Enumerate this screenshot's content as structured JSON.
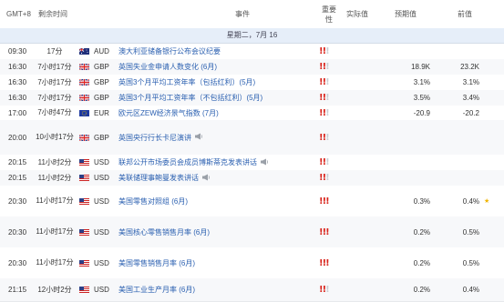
{
  "header": {
    "gmt": "GMT+8",
    "remaining": "剩余时间",
    "event": "事件",
    "importance_line1": "重要",
    "importance_line2": "性",
    "actual": "实际值",
    "forecast": "预期值",
    "previous": "前值"
  },
  "date_bar": "星期二，7月 16",
  "colors": {
    "accent_link": "#2a5fb0",
    "importance_high": "#d9251d",
    "importance_low": "#c9cdd3",
    "date_bar_bg": "#e6eef9"
  },
  "rows": [
    {
      "time": "09:30",
      "remaining": "17分",
      "flag": "AU",
      "currency": "AUD",
      "event": "澳大利亚储备银行公布会议纪要",
      "speech": false,
      "importance": 2,
      "actual": "",
      "forecast": "",
      "previous": "",
      "star": false
    },
    {
      "time": "16:30",
      "remaining": "7小时17分",
      "flag": "GB",
      "currency": "GBP",
      "event": "英国失业金申请人数变化 (6月)",
      "speech": false,
      "importance": 2,
      "actual": "",
      "forecast": "18.9K",
      "previous": "23.2K",
      "star": false
    },
    {
      "time": "16:30",
      "remaining": "7小时17分",
      "flag": "GB",
      "currency": "GBP",
      "event": "英国3个月平均工资年率（包括红利）(5月)",
      "speech": false,
      "importance": 2,
      "actual": "",
      "forecast": "3.1%",
      "previous": "3.1%",
      "star": false
    },
    {
      "time": "16:30",
      "remaining": "7小时17分",
      "flag": "GB",
      "currency": "GBP",
      "event": "英国3个月平均工资年率（不包括红利）(5月)",
      "speech": false,
      "importance": 2,
      "actual": "",
      "forecast": "3.5%",
      "previous": "3.4%",
      "star": false
    },
    {
      "time": "17:00",
      "remaining": "7小时47分",
      "flag": "EU",
      "currency": "EUR",
      "event": "欧元区ZEW经济景气指数 (7月)",
      "speech": false,
      "importance": 2,
      "actual": "",
      "forecast": "-20.9",
      "previous": "-20.2",
      "star": false
    },
    {
      "time": "20:00",
      "remaining": "10小时17分",
      "flag": "GB",
      "currency": "GBP",
      "event": "英国央行行长卡尼演讲",
      "speech": true,
      "importance": 2,
      "actual": "",
      "forecast": "",
      "previous": "",
      "star": false
    },
    {
      "time": "20:15",
      "remaining": "11小时2分",
      "flag": "US",
      "currency": "USD",
      "event": "联邦公开市场委员会成员博斯蒂克发表讲话",
      "speech": true,
      "importance": 2,
      "actual": "",
      "forecast": "",
      "previous": "",
      "star": false
    },
    {
      "time": "20:15",
      "remaining": "11小时2分",
      "flag": "US",
      "currency": "USD",
      "event": "美联储理事鲍曼发表讲话",
      "speech": true,
      "importance": 2,
      "actual": "",
      "forecast": "",
      "previous": "",
      "star": false
    },
    {
      "time": "20:30",
      "remaining": "11小时17分",
      "flag": "US",
      "currency": "USD",
      "event": "美国零售对照组 (6月)",
      "speech": false,
      "importance": 3,
      "actual": "",
      "forecast": "0.3%",
      "previous": "0.4%",
      "star": true
    },
    {
      "time": "20:30",
      "remaining": "11小时17分",
      "flag": "US",
      "currency": "USD",
      "event": "美国核心零售销售月率 (6月)",
      "speech": false,
      "importance": 3,
      "actual": "",
      "forecast": "0.2%",
      "previous": "0.5%",
      "star": false
    },
    {
      "time": "20:30",
      "remaining": "11小时17分",
      "flag": "US",
      "currency": "USD",
      "event": "美国零售销售月率 (6月)",
      "speech": false,
      "importance": 3,
      "actual": "",
      "forecast": "0.2%",
      "previous": "0.5%",
      "star": false
    },
    {
      "time": "21:15",
      "remaining": "12小时2分",
      "flag": "US",
      "currency": "USD",
      "event": "美国工业生产月率 (6月)",
      "speech": false,
      "importance": 2,
      "actual": "",
      "forecast": "0.2%",
      "previous": "0.4%",
      "star": false
    }
  ]
}
